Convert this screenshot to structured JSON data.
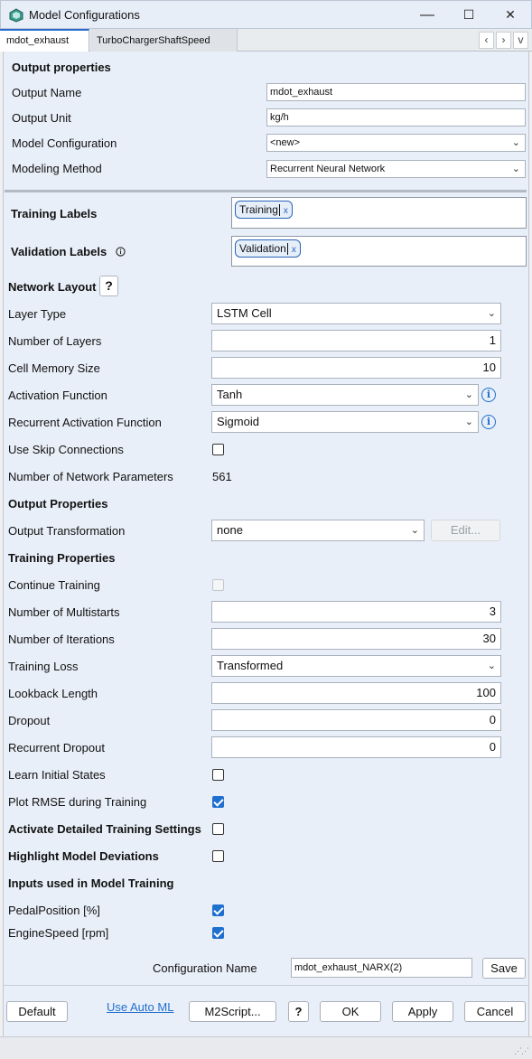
{
  "window": {
    "title": "Model Configurations",
    "minimize": "—",
    "maximize": "☐",
    "close": "✕"
  },
  "tabs": [
    "mdot_exhaust",
    "TurboChargerShaftSpeed"
  ],
  "tab_nav": {
    "prev": "‹",
    "next": "›",
    "menu": "v"
  },
  "output_properties": {
    "header": "Output properties",
    "output_name_label": "Output Name",
    "output_name_value": "mdot_exhaust",
    "output_unit_label": "Output Unit",
    "output_unit_value": "kg/h",
    "model_config_label": "Model Configuration",
    "model_config_value": "<new>",
    "modeling_method_label": "Modeling Method",
    "modeling_method_value": "Recurrent Neural Network"
  },
  "labels": {
    "training_label": "Training Labels",
    "training_tag": "Training",
    "validation_label": "Validation Labels",
    "validation_tag": "Validation",
    "tag_remove": "x"
  },
  "network_layout": {
    "header": "Network Layout",
    "help": "?",
    "layer_type_label": "Layer Type",
    "layer_type_value": "LSTM Cell",
    "num_layers_label": "Number of Layers",
    "num_layers_value": "1",
    "cell_memory_label": "Cell Memory Size",
    "cell_memory_value": "10",
    "activation_label": "Activation Function",
    "activation_value": "Tanh",
    "recurrent_activation_label": "Recurrent Activation Function",
    "recurrent_activation_value": "Sigmoid",
    "skip_label": "Use Skip Connections",
    "params_label": "Number of Network Parameters",
    "params_value": "561"
  },
  "output_props": {
    "header": "Output Properties",
    "transformation_label": "Output Transformation",
    "transformation_value": "none",
    "edit_button": "Edit..."
  },
  "training_properties": {
    "header": "Training Properties",
    "continue_label": "Continue Training",
    "multistarts_label": "Number of Multistarts",
    "multistarts_value": "3",
    "iterations_label": "Number of Iterations",
    "iterations_value": "30",
    "loss_label": "Training Loss",
    "loss_value": "Transformed",
    "lookback_label": "Lookback Length",
    "lookback_value": "100",
    "dropout_label": "Dropout",
    "dropout_value": "0",
    "recurrent_dropout_label": "Recurrent Dropout",
    "recurrent_dropout_value": "0",
    "learn_initial_label": "Learn Initial States",
    "plot_rmse_label": "Plot RMSE during Training"
  },
  "detailed_settings_label": "Activate Detailed Training Settings",
  "highlight_label": "Highlight Model Deviations",
  "inputs": {
    "header": "Inputs used in Model Training",
    "items": [
      "PedalPosition [%]",
      "EngineSpeed [rpm]"
    ]
  },
  "config_name": {
    "label": "Configuration Name",
    "value": "mdot_exhaust_NARX(2)",
    "save": "Save"
  },
  "footer": {
    "default": "Default",
    "auto_ml": "Use Auto ML",
    "m2script": "M2Script...",
    "help": "?",
    "ok": "OK",
    "apply": "Apply",
    "cancel": "Cancel"
  },
  "checkbox_state": {
    "skip_connections": false,
    "continue_training": false,
    "learn_initial_states": false,
    "plot_rmse": true,
    "detailed_settings": false,
    "highlight_deviations": false,
    "pedal_position": true,
    "engine_speed": true
  },
  "colors": {
    "accent": "#1f6fcf",
    "panel": "#e9eff8"
  }
}
